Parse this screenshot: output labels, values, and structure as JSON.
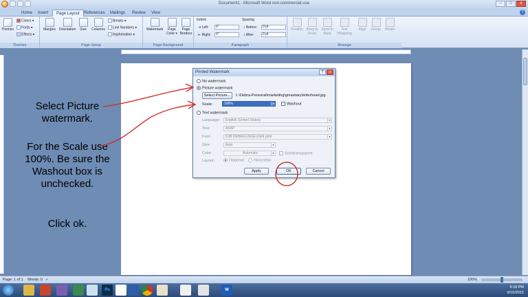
{
  "window": {
    "title": "Document1 - Microsoft Word non-commercial use",
    "minimize": "–",
    "maximize": "□",
    "close": "x"
  },
  "tabs": [
    "Home",
    "Insert",
    "Page Layout",
    "References",
    "Mailings",
    "Review",
    "View"
  ],
  "active_tab": "Page Layout",
  "ribbon": {
    "themes": {
      "label": "Themes",
      "big": "Themes",
      "colors": "Colors ▾",
      "fonts": "Fonts ▾",
      "effects": "Effects ▾"
    },
    "page_setup": {
      "label": "Page Setup",
      "margins": "Margins",
      "orientation": "Orientation",
      "size": "Size",
      "columns": "Columns",
      "breaks": "Breaks ▾",
      "line_numbers": "Line Numbers ▾",
      "hyphenation": "Hyphenation ▾"
    },
    "page_background": {
      "label": "Page Background",
      "watermark": "Watermark",
      "page_color": "Page Color ▾",
      "page_borders": "Page Borders"
    },
    "paragraph": {
      "label": "Paragraph",
      "indent": "Indent",
      "left": "Left:",
      "left_val": "0\"",
      "right": "Right:",
      "right_val": "0\"",
      "spacing": "Spacing",
      "before": "Before:",
      "before_val": "0 pt",
      "after": "After:",
      "after_val": "0 pt"
    },
    "arrange": {
      "label": "Arrange",
      "position": "Position",
      "bring_to_front": "Bring to Front",
      "send_to_back": "Send to Back",
      "text_wrapping": "Text Wrapping",
      "align": "Align",
      "group": "Group",
      "rotate": "Rotate"
    }
  },
  "instructions": {
    "line1": "Select Picture watermark.",
    "line2": "For the Scale use 100%. Be sure the Washout box is unchecked.",
    "line3": "Click ok."
  },
  "dialog": {
    "title": "Printed Watermark",
    "help": "?",
    "close": "x",
    "no_watermark": "No watermark",
    "picture_watermark": "Picture watermark",
    "select_picture": "Select Picture...",
    "picture_path": "L:\\Debra-Personal\\marketing\\gmastiary\\letterhead.jpg",
    "scale_label": "Scale:",
    "scale_value": "100%",
    "washout": "Washout",
    "text_watermark": "Text watermark",
    "language_label": "Language:",
    "language_value": "English (United States)",
    "text_label": "Text:",
    "text_value": "ASAP",
    "font_label": "Font:",
    "font_value": "DJB DEBRA ENGELKEN print",
    "size_label": "Size:",
    "size_value": "Auto",
    "color_label": "Color:",
    "color_value": "Automatic",
    "semitransparent": "Semitransparent",
    "layout_label": "Layout:",
    "diagonal": "Diagonal",
    "horizontal": "Horizontal",
    "apply": "Apply",
    "ok": "OK",
    "cancel": "Cancel"
  },
  "status": {
    "page": "Page: 1 of 1",
    "words": "Words: 0",
    "zoom": "100%"
  },
  "taskbar": {
    "time": "9:18 PM",
    "date": "9/16/2015",
    "apps": [
      "Ps",
      "W"
    ]
  },
  "colors": {
    "accent": "#3f74c6",
    "annotation": "#d0312d",
    "background": "#6e8cb4"
  }
}
